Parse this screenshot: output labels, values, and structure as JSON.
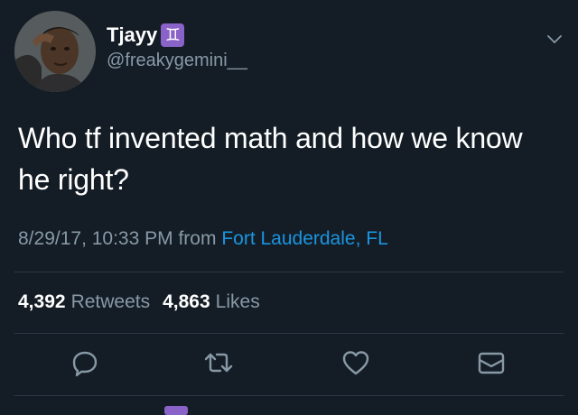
{
  "user": {
    "display_name": "Tjayy",
    "badge": "♊",
    "handle": "@freakygemini__"
  },
  "tweet": {
    "text_line1": "Who tf invented math and how we know",
    "text_line2": "he right?",
    "timestamp": "8/29/17, 10:33 PM",
    "from_label": "from",
    "location": "Fort Lauderdale, FL"
  },
  "stats": {
    "retweets_count": "4,392",
    "retweets_label": "Retweets",
    "likes_count": "4,863",
    "likes_label": "Likes"
  },
  "icons": {
    "reply": "reply-icon",
    "retweet": "retweet-icon",
    "like": "heart-icon",
    "dm": "envelope-icon",
    "menu": "chevron-down-icon"
  },
  "colors": {
    "background": "#141d26",
    "accent": "#1b95e0",
    "muted": "#8899a6",
    "badge": "#8a63c9"
  }
}
